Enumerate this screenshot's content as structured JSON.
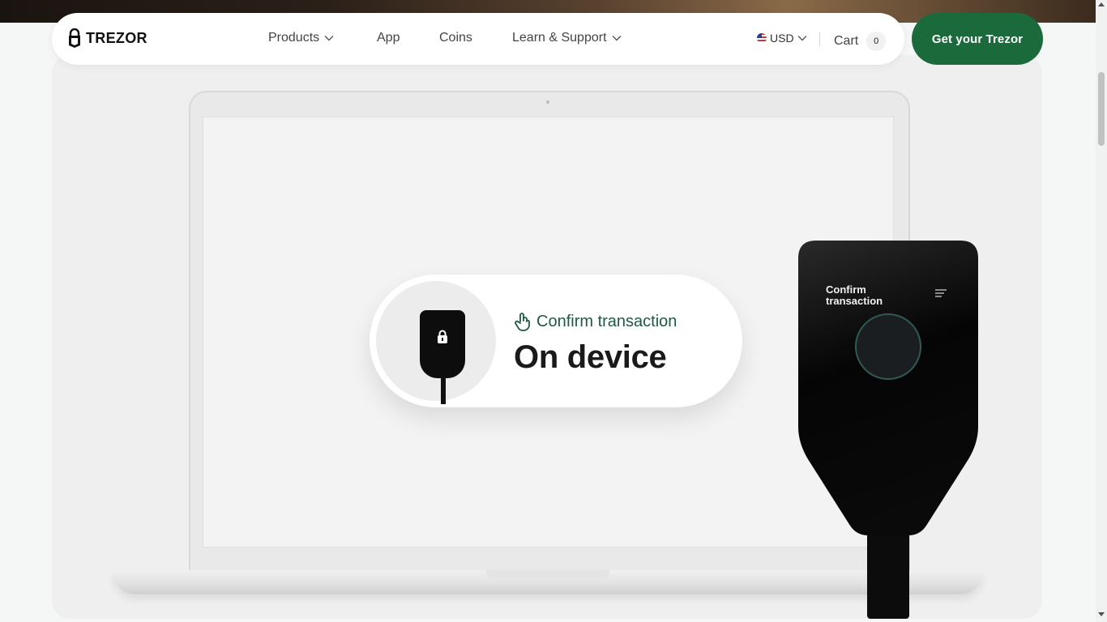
{
  "nav": {
    "brand": "TREZOR",
    "items": [
      {
        "label": "Products",
        "has_dropdown": true
      },
      {
        "label": "App",
        "has_dropdown": false
      },
      {
        "label": "Coins",
        "has_dropdown": false
      },
      {
        "label": "Learn & Support",
        "has_dropdown": true
      }
    ],
    "currency": "USD",
    "cart_label": "Cart",
    "cart_count": "0",
    "cta": "Get your Trezor"
  },
  "hero": {
    "pill_subtitle": "Confirm transaction",
    "pill_title": "On device",
    "device_screen_text": "Confirm transaction"
  },
  "colors": {
    "accent_green": "#1b6a3c",
    "pill_text_green": "#1e5a43",
    "background": "#f5f6f6"
  }
}
